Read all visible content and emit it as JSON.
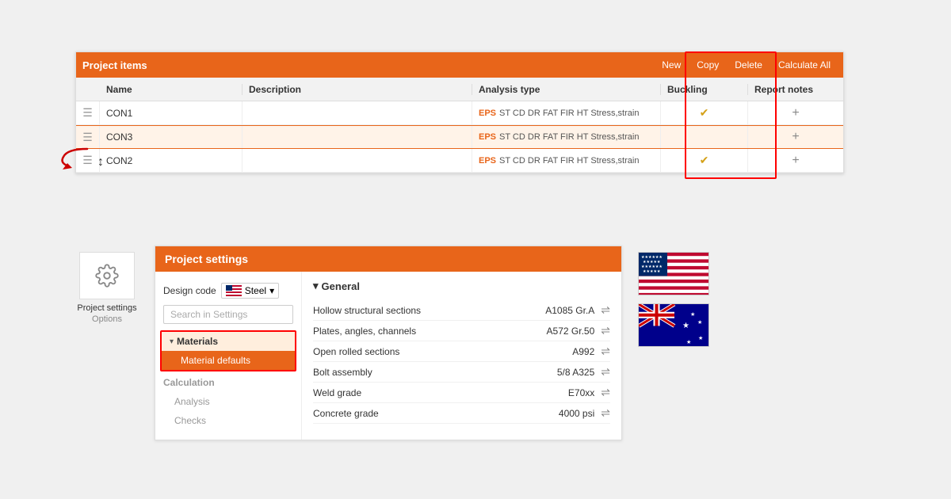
{
  "table": {
    "title": "Project items",
    "actions": [
      "New",
      "Copy",
      "Delete",
      "Calculate All"
    ],
    "columns": [
      "",
      "Name",
      "Description",
      "Analysis type",
      "Buckling",
      "Report notes"
    ],
    "rows": [
      {
        "name": "CON1",
        "description": "",
        "analysis": "EPS ST CD DR FAT FIR HT Stress,strain",
        "buckling": true,
        "report": true,
        "highlighted": false
      },
      {
        "name": "CON3",
        "description": "",
        "analysis": "EPS ST CD DR FAT FIR HT Stress,strain",
        "buckling": false,
        "report": true,
        "highlighted": true
      },
      {
        "name": "CON2",
        "description": "",
        "analysis": "EPS ST CD DR FAT FIR HT Stress,strain",
        "buckling": true,
        "report": true,
        "highlighted": false
      }
    ]
  },
  "settings": {
    "title": "Project settings",
    "design_code_label": "Design code",
    "design_code_value": "Steel",
    "search_placeholder": "Search in Settings",
    "nav": [
      {
        "group": "Materials",
        "items": [
          "Material defaults"
        ],
        "expanded": true,
        "active": true
      },
      {
        "group": "Calculation",
        "items": [],
        "expanded": false,
        "active": false
      },
      {
        "group": "Analysis",
        "items": [],
        "expanded": false,
        "active": false
      },
      {
        "group": "Checks",
        "items": [],
        "expanded": false,
        "active": false
      }
    ],
    "general": {
      "title": "General",
      "rows": [
        {
          "label": "Hollow structural sections",
          "value": "A1085 Gr.A"
        },
        {
          "label": "Plates, angles, channels",
          "value": "A572 Gr.50"
        },
        {
          "label": "Open rolled sections",
          "value": "A992"
        },
        {
          "label": "Bolt assembly",
          "value": "5/8 A325"
        },
        {
          "label": "Weld grade",
          "value": "E70xx"
        },
        {
          "label": "Concrete grade",
          "value": "4000 psi"
        }
      ]
    }
  },
  "icon": {
    "label": "Project settings",
    "sublabel": "Options"
  },
  "colors": {
    "orange": "#e8651a",
    "highlight_orange": "#fff3e8",
    "red_annotation": "#cc0000"
  }
}
